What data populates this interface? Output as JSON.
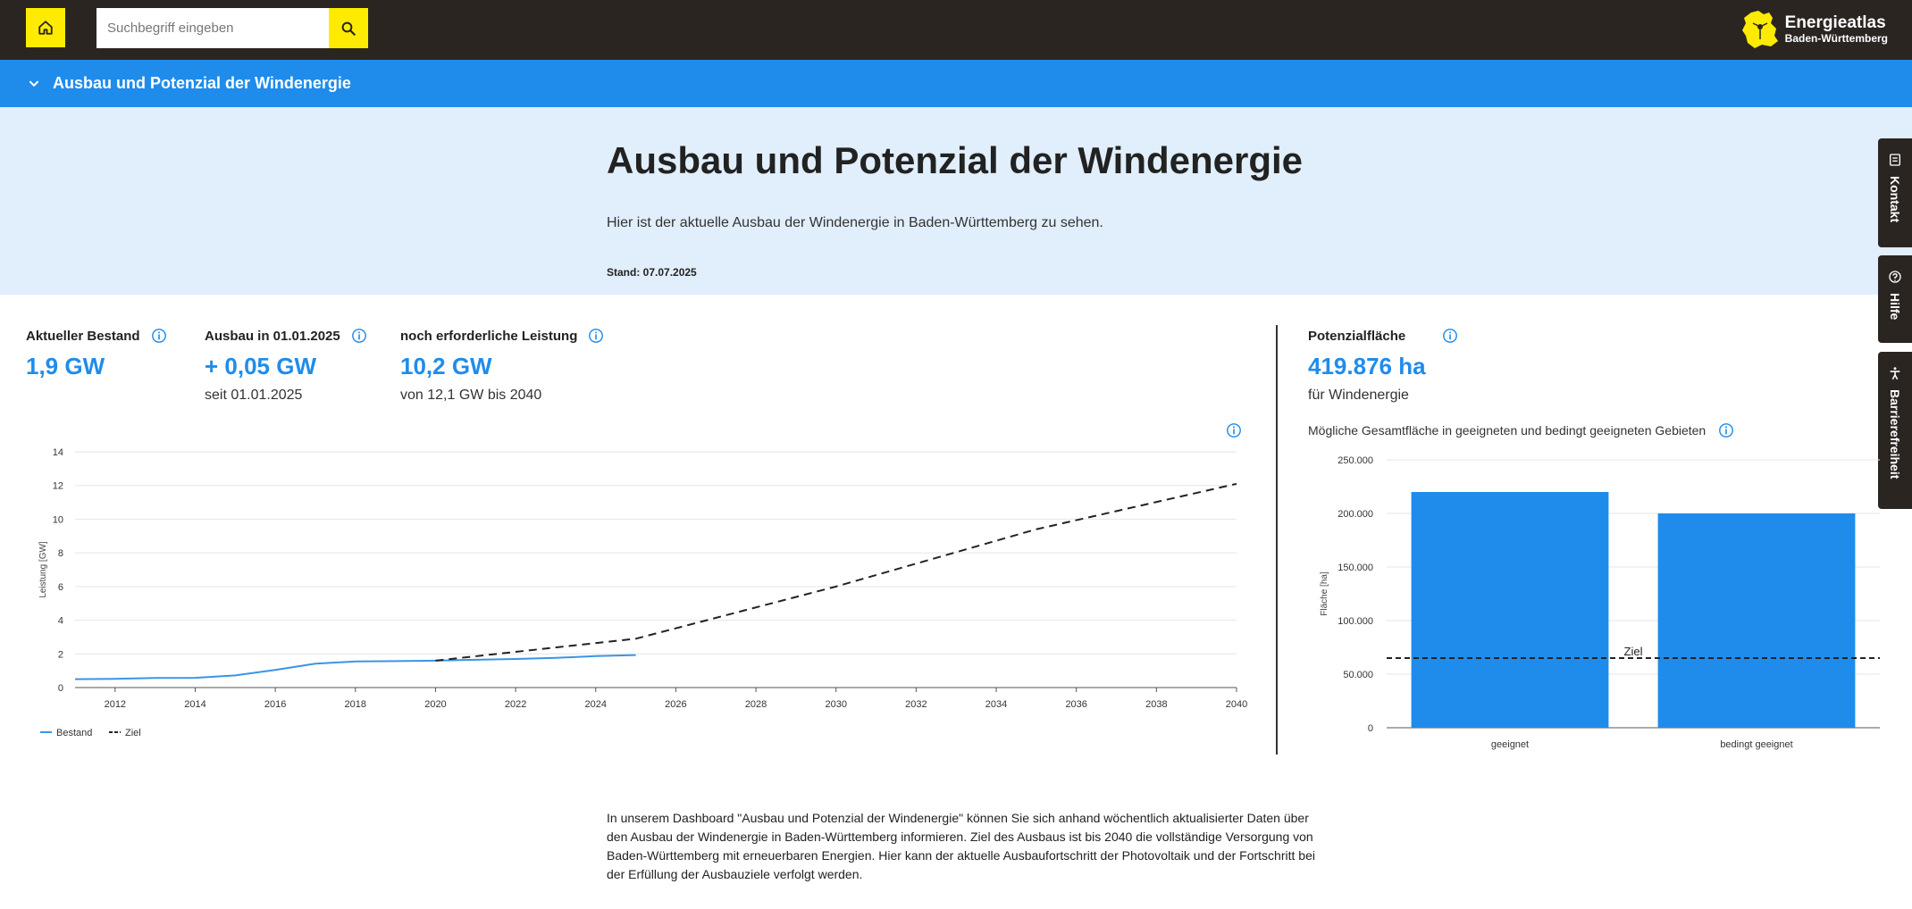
{
  "search": {
    "placeholder": "Suchbegriff eingeben"
  },
  "logo": {
    "title": "Energieatlas",
    "subtitle": "Baden-Württemberg"
  },
  "nav": {
    "section_label": "Ausbau und Potenzial der Windenergie"
  },
  "hero": {
    "title": "Ausbau und Potenzial der Windenergie",
    "text": "Hier ist der aktuelle Ausbau der Windenergie in Baden-Württemberg zu sehen.",
    "stand": "Stand: 07.07.2025"
  },
  "side_tabs": [
    {
      "label": "Kontakt",
      "icon": "contact-icon"
    },
    {
      "label": "Hilfe",
      "icon": "help-icon"
    },
    {
      "label": "Barrierefreiheit",
      "icon": "accessibility-icon"
    }
  ],
  "kpis": [
    {
      "label": "Aktueller Bestand",
      "value": "1,9 GW",
      "sub": ""
    },
    {
      "label": "Ausbau in 01.01.2025",
      "value": "+ 0,05 GW",
      "sub": "seit 01.01.2025"
    },
    {
      "label": "noch erforderliche Leistung",
      "value": "10,2 GW",
      "sub": "von 12,1 GW bis 2040"
    }
  ],
  "potential": {
    "label": "Potenzialfläche",
    "value": "419.876 ha",
    "sub": "für Windenergie",
    "chart_caption": "Mögliche Gesamtfläche in geeigneten und bedingt geeigneten Gebieten"
  },
  "bottom_text": "In unserem Dashboard \"Ausbau und Potenzial der Windenergie\" können Sie sich anhand wöchentlich aktualisierter Daten über den Ausbau der Windenergie in Baden-Württemberg informieren. Ziel des Ausbaus ist bis 2040 die vollständige Versorgung von Baden-Württemberg mit erneuerbaren Energien. Hier kann der aktuelle Ausbaufortschritt der Photovoltaik und der Fortschritt bei der Erfüllung der Ausbauziele verfolgt werden.",
  "chart_data": [
    {
      "type": "line",
      "ylabel": "Leistung [GW]",
      "xlim": [
        2011,
        2040
      ],
      "ylim": [
        0,
        14
      ],
      "x_ticks": [
        "2012",
        "2014",
        "2016",
        "2018",
        "2020",
        "2022",
        "2024",
        "2026",
        "2028",
        "2030",
        "2032",
        "2034",
        "2036",
        "2038",
        "2040"
      ],
      "y_ticks": [
        "0",
        "2",
        "4",
        "6",
        "8",
        "10",
        "12",
        "14"
      ],
      "grid": true,
      "legend_position": "bottom-left",
      "series": [
        {
          "name": "Bestand",
          "color": "#3b94e6",
          "dash": false,
          "x": [
            2011,
            2012,
            2013,
            2014,
            2015,
            2016,
            2017,
            2018,
            2019,
            2020,
            2021,
            2022,
            2023,
            2024,
            2025
          ],
          "y": [
            0.5,
            0.52,
            0.57,
            0.58,
            0.72,
            1.05,
            1.42,
            1.55,
            1.57,
            1.6,
            1.65,
            1.7,
            1.76,
            1.87,
            1.93
          ]
        },
        {
          "name": "Ziel",
          "color": "#222222",
          "dash": true,
          "x": [
            2020,
            2025,
            2030,
            2035,
            2040
          ],
          "y": [
            1.6,
            2.9,
            6.0,
            9.4,
            12.1
          ]
        }
      ]
    },
    {
      "type": "bar",
      "ylabel": "Fläche [ha]",
      "categories": [
        "geeignet",
        "bedingt geeignet"
      ],
      "values": [
        220000,
        200000
      ],
      "color": "#1f8ceb",
      "ylim": [
        0,
        250000
      ],
      "y_ticks": [
        "0",
        "50.000",
        "100.000",
        "150.000",
        "200.000",
        "250.000"
      ],
      "target": {
        "label": "Ziel",
        "value": 65000
      },
      "grid": true
    }
  ]
}
